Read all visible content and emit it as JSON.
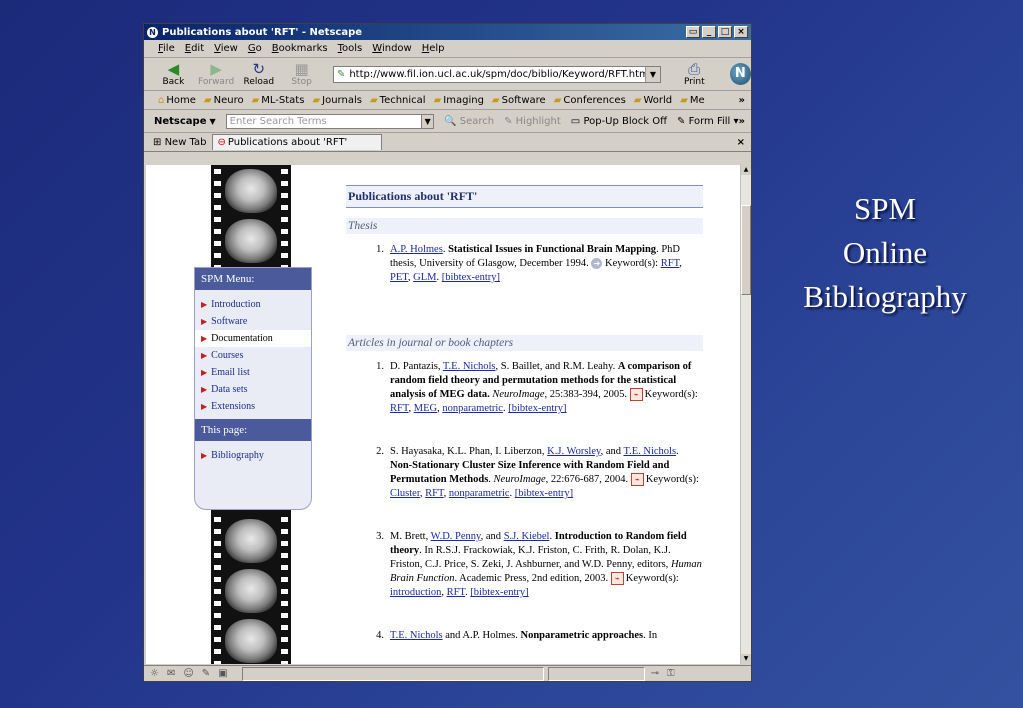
{
  "slide": {
    "title_lines": [
      "SPM",
      "Online",
      "Bibliography"
    ]
  },
  "window": {
    "title": "Publications about 'RFT' - Netscape",
    "menu": [
      "File",
      "Edit",
      "View",
      "Go",
      "Bookmarks",
      "Tools",
      "Window",
      "Help"
    ],
    "nav": {
      "back": "Back",
      "forward": "Forward",
      "reload": "Reload",
      "stop": "Stop",
      "print": "Print"
    },
    "url": "http://www.fil.ion.ucl.ac.uk/spm/doc/biblio/Keyword/RFT.html",
    "bookmarks": [
      "Home",
      "Neuro",
      "ML-Stats",
      "Journals",
      "Technical",
      "Imaging",
      "Software",
      "Conferences",
      "World",
      "Me"
    ],
    "search": {
      "brand": "Netscape",
      "placeholder": "Enter Search Terms",
      "search_btn": "Search",
      "highlight_btn": "Highlight",
      "popup_btn": "Pop-Up Block Off",
      "formfill_btn": "Form Fill"
    },
    "tabs": {
      "new_tab": "New Tab",
      "active": "Publications about 'RFT'"
    }
  },
  "spm_menu": {
    "header": "SPM Menu:",
    "items": [
      "Introduction",
      "Software",
      "Documentation",
      "Courses",
      "Email list",
      "Data sets",
      "Extensions"
    ],
    "this_page_header": "This page:",
    "this_page_items": [
      "Bibliography"
    ]
  },
  "doc": {
    "title": "Publications about 'RFT'",
    "sections": [
      "Thesis",
      "Articles in journal or book chapters"
    ],
    "entries": [
      {
        "num": "1.",
        "authors_link": "A.P. Holmes",
        "title": "Statistical Issues in Functional Brain Mapping",
        "rest": "PhD thesis, University of Glasgow, December 1994.",
        "kw_label": "Keyword(s):",
        "keywords": [
          "RFT",
          "PET",
          "GLM"
        ],
        "bibtex": "[bibtex-entry]"
      },
      {
        "num": "1.",
        "pre": "D. Pantazis,",
        "a1": "T.E. Nichols",
        "post": ", S. Baillet, and R.M. Leahy.",
        "title": "A comparison of random field theory and permutation methods for the statistical analysis of MEG data.",
        "journal": "NeuroImage",
        "rest": ", 25:383-394, 2005.",
        "kw_label": "Keyword(s):",
        "keywords": [
          "RFT",
          "MEG",
          "nonparametric"
        ],
        "bibtex": "[bibtex-entry]"
      },
      {
        "num": "2.",
        "pre": "S. Hayasaka, K.L. Phan, I. Liberzon,",
        "a1": "K.J. Worsley",
        "mid": ", and",
        "a2": "T.E. Nichols",
        "title": "Non-Stationary Cluster Size Inference with Random Field and Permutation Methods",
        "journal": "NeuroImage",
        "rest": ", 22:676-687, 2004.",
        "kw_label": "Keyword(s):",
        "keywords": [
          "Cluster",
          "RFT",
          "nonparametric"
        ],
        "bibtex": "[bibtex-entry]"
      },
      {
        "num": "3.",
        "pre": "M. Brett,",
        "a1": "W.D. Penny",
        "mid": ", and",
        "a2": "S.J. Kiebel",
        "title": "Introduction to Random field theory",
        "rest": ". In R.S.J. Frackowiak, K.J. Friston, C. Frith, R. Dolan, K.J. Friston, C.J. Price, S. Zeki, J. Ashburner, and W.D. Penny, editors,",
        "book": "Human Brain Function",
        "rest2": ". Academic Press, 2nd edition, 2003.",
        "kw_label": "Keyword(s):",
        "keywords": [
          "introduction",
          "RFT"
        ],
        "bibtex": "[bibtex-entry]"
      },
      {
        "num": "4.",
        "a1": "T.E. Nichols",
        "post": " and A.P. Holmes.",
        "title": "Nonparametric approaches",
        "rest": ". In"
      }
    ]
  }
}
